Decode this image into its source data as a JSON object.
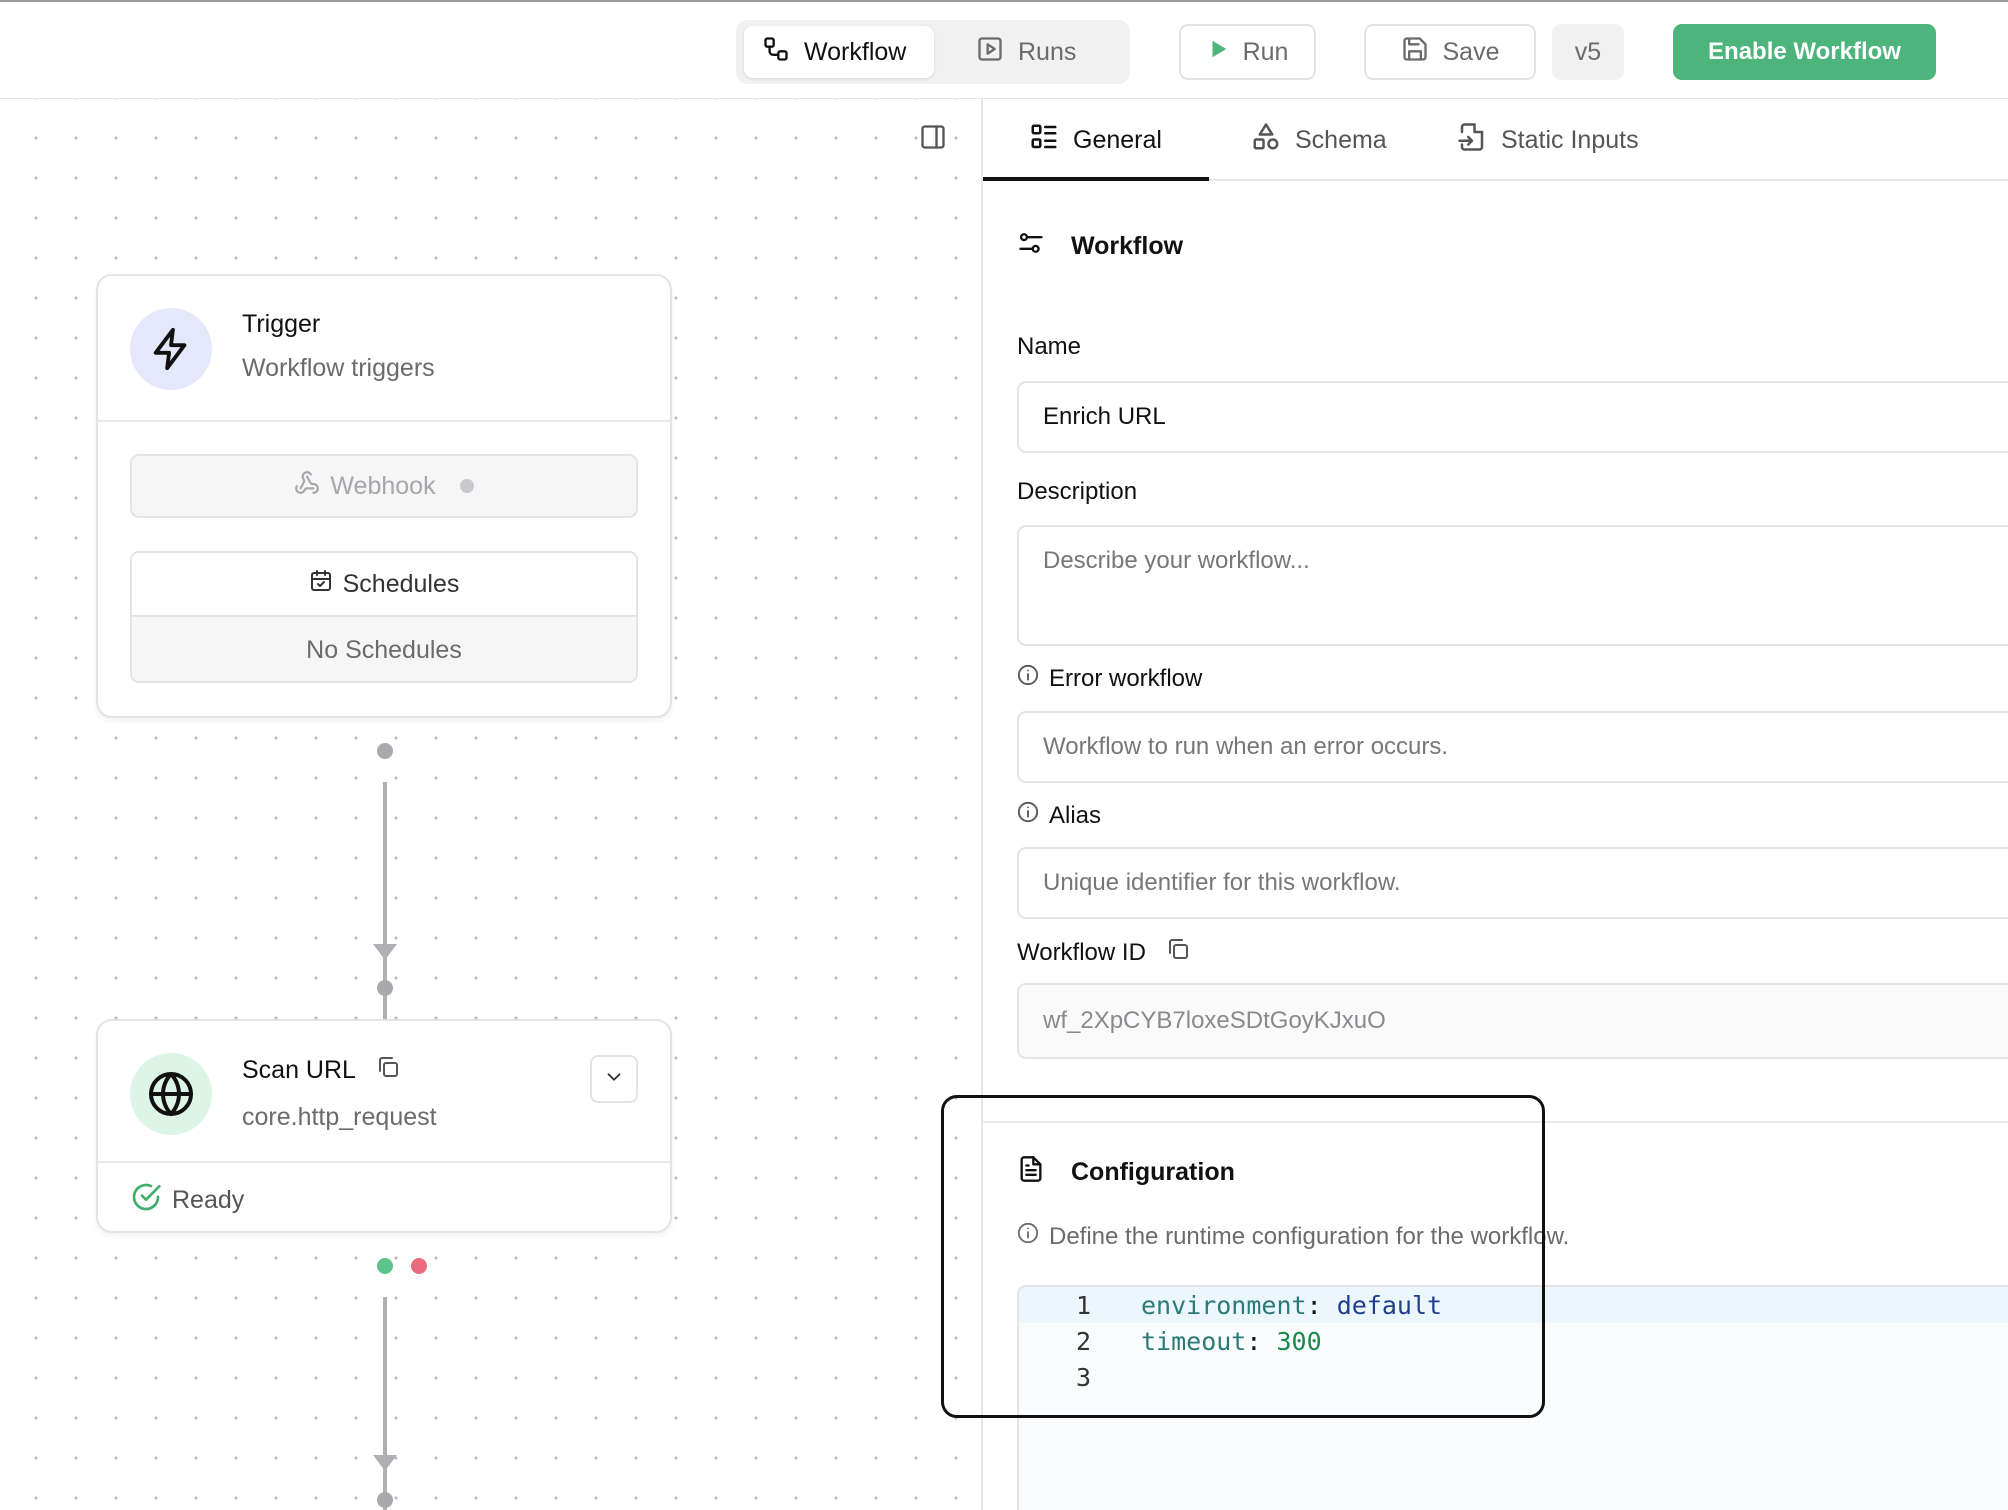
{
  "header": {
    "tabs": [
      {
        "label": "Workflow",
        "icon": "workflow-icon",
        "active": true
      },
      {
        "label": "Runs",
        "icon": "runs-icon",
        "active": false
      }
    ],
    "run_label": "Run",
    "save_label": "Save",
    "version": "v5",
    "enable_label": "Enable Workflow",
    "colors": {
      "accent": "#4db47c"
    }
  },
  "canvas": {
    "trigger": {
      "title": "Trigger",
      "subtitle": "Workflow triggers",
      "webhook_label": "Webhook",
      "schedules_label": "Schedules",
      "schedules_empty": "No Schedules"
    },
    "scan": {
      "title": "Scan URL",
      "subtitle": "core.http_request",
      "status": "Ready"
    }
  },
  "panel": {
    "tabs": [
      {
        "label": "General",
        "active": true
      },
      {
        "label": "Schema",
        "active": false
      },
      {
        "label": "Static Inputs",
        "active": false
      }
    ],
    "workflow_section": {
      "title": "Workflow",
      "name_label": "Name",
      "name_value": "Enrich URL",
      "description_label": "Description",
      "description_placeholder": "Describe your workflow...",
      "error_label": "Error workflow",
      "error_placeholder": "Workflow to run when an error occurs.",
      "alias_label": "Alias",
      "alias_placeholder": "Unique identifier for this workflow.",
      "id_label": "Workflow ID",
      "id_value": "wf_2XpCYB7loxeSDtGoyKJxuO"
    },
    "configuration": {
      "title": "Configuration",
      "help": "Define the runtime configuration for the workflow.",
      "lines": [
        {
          "num": "1",
          "key": "environment",
          "value": "default"
        },
        {
          "num": "2",
          "key": "timeout",
          "value": "300"
        },
        {
          "num": "3",
          "key": "",
          "value": ""
        }
      ]
    }
  }
}
